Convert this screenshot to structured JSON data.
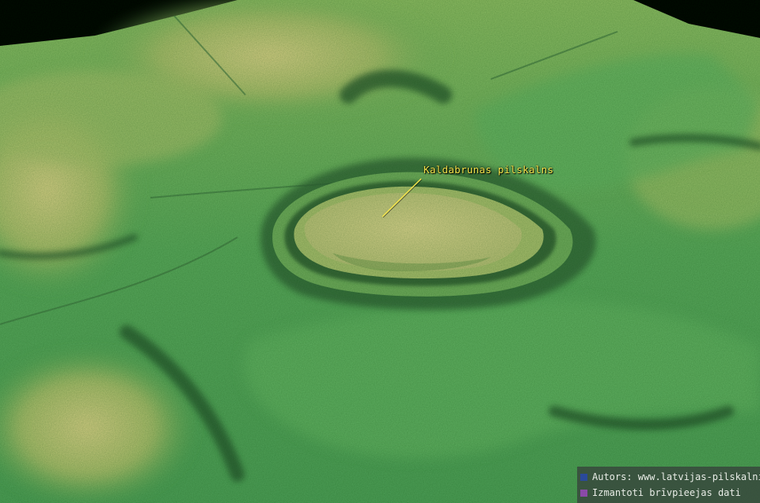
{
  "map": {
    "type": "3d-lidar-relief",
    "feature_label": "Kaldabrunas pilskalns",
    "colors": {
      "sky": "#000000",
      "lowland": "#4fa35a",
      "mid": "#7cb85e",
      "high": "#c8c77a",
      "label": "#f2e34a"
    }
  },
  "credits": [
    {
      "icon": "blue-square",
      "color": "#2a4a9a",
      "text": "Autors: www.latvijas-pilskalni.lv"
    },
    {
      "icon": "purple-square",
      "color": "#8a4aa8",
      "text": "Izmantoti brīvpieejas dati"
    }
  ]
}
